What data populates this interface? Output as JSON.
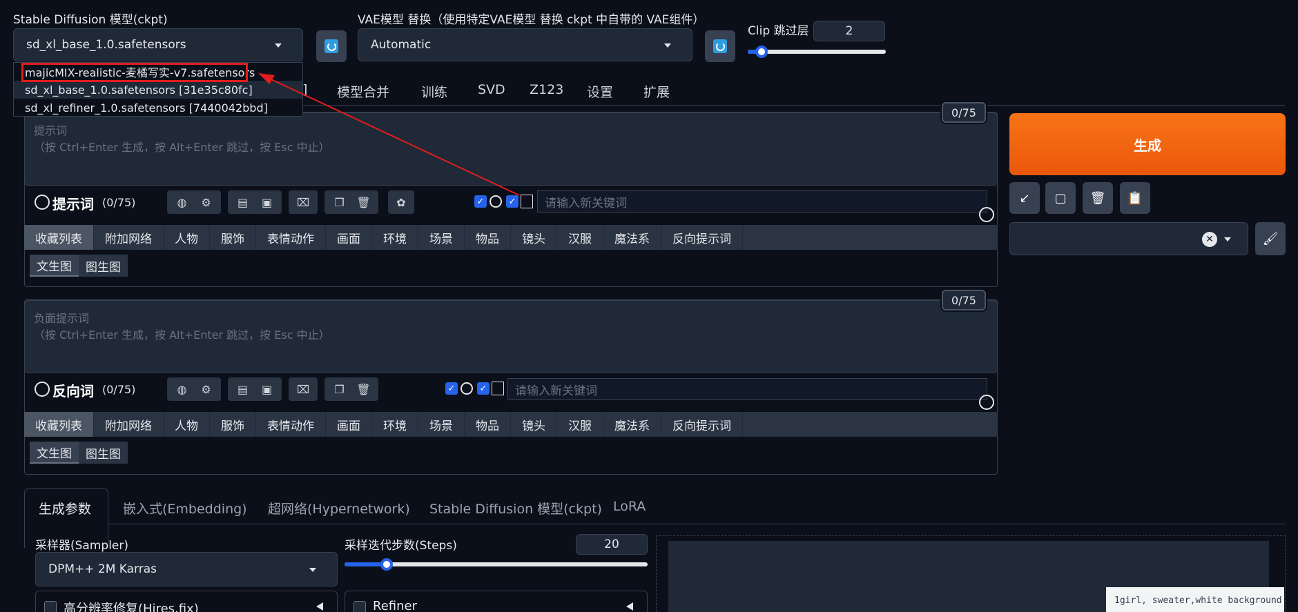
{
  "header": {
    "sd_model_label": "Stable Diffusion 模型(ckpt)",
    "sd_model_value": "sd_xl_base_1.0.safetensors",
    "vae_label": "VAE模型 替换（使用特定VAE模型 替换 ckpt 中自带的 VAE组件）",
    "vae_value": "Automatic",
    "clip_label": "Clip 跳过层",
    "clip_value": "2",
    "clip_progress": 0.1
  },
  "model_dropdown": {
    "items": [
      "majicMIX-realistic-麦橘写实-v7.safetensors",
      "sd_xl_base_1.0.safetensors [31e35c80fc]",
      "sd_xl_refiner_1.0.safetensors [7440042bbd]"
    ]
  },
  "main_tabs": [
    "模型合并",
    "训练",
    "SVD",
    "Z123",
    "设置",
    "扩展"
  ],
  "prompt": {
    "placeholder_line1": "提示词",
    "placeholder_line2": "（按 Ctrl+Enter 生成，按 Alt+Enter 跳过，按 Esc 中止）",
    "counter": "0/75",
    "title": "提示词",
    "count": "(0/75)",
    "keyword_placeholder": "请输入新关键词"
  },
  "negative": {
    "placeholder_line1": "负面提示词",
    "placeholder_line2": "（按 Ctrl+Enter 生成，按 Alt+Enter 跳过，按 Esc 中止）",
    "counter": "0/75",
    "title": "反向词",
    "count": "(0/75)",
    "keyword_placeholder": "请输入新关键词"
  },
  "categories": [
    "收藏列表",
    "附加网络",
    "人物",
    "服饰",
    "表情动作",
    "画面",
    "环境",
    "场景",
    "物品",
    "镜头",
    "汉服",
    "魔法系",
    "反向提示词"
  ],
  "subtabs": [
    "文生图",
    "图生图"
  ],
  "generate_label": "生成",
  "param_tabs": [
    "生成参数",
    "嵌入式(Embedding)",
    "超网络(Hypernetwork)",
    "Stable Diffusion 模型(ckpt)",
    "LoRA"
  ],
  "params": {
    "sampler_label": "采样器(Sampler)",
    "sampler_value": "DPM++ 2M Karras",
    "steps_label": "采样迭代步数(Steps)",
    "steps_value": "20",
    "steps_progress": 0.14,
    "hires_label": "高分辨率修复(Hires.fix)",
    "refiner_label": "Refiner"
  },
  "preview_caption": "1girl, sweater,white background",
  "icons": {
    "refresh": "refresh-icon",
    "globe": "globe-icon",
    "gear": "gear-icon",
    "chevron": "chevron-down-icon"
  },
  "colors": {
    "accent_orange": "#f97316",
    "slider_blue": "#2563eb",
    "highlight_red": "#e11d1d"
  }
}
